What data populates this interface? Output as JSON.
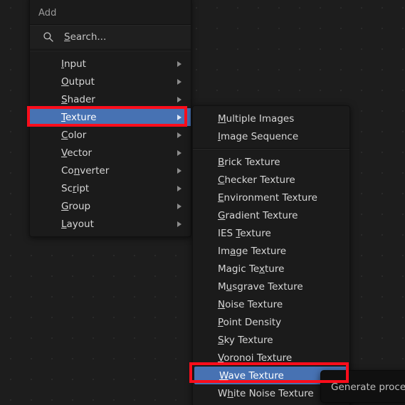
{
  "app": {
    "background_color": "#1d1d1d",
    "accent_color": "#4772b3",
    "annotation_color": "#fb0d1b"
  },
  "add_menu": {
    "title": "Add",
    "search": {
      "icon": "search-icon",
      "placeholder": "Search...",
      "value": ""
    },
    "items": [
      {
        "label": "Input",
        "accel": "I",
        "has_submenu": true,
        "selected": false
      },
      {
        "label": "Output",
        "accel": "O",
        "has_submenu": true,
        "selected": false
      },
      {
        "label": "Shader",
        "accel": "S",
        "has_submenu": true,
        "selected": false
      },
      {
        "label": "Texture",
        "accel": "T",
        "has_submenu": true,
        "selected": true
      },
      {
        "label": "Color",
        "accel": "C",
        "has_submenu": true,
        "selected": false
      },
      {
        "label": "Vector",
        "accel": "V",
        "has_submenu": true,
        "selected": false
      },
      {
        "label": "Converter",
        "accel": "n",
        "has_submenu": true,
        "selected": false
      },
      {
        "label": "Script",
        "accel": "r",
        "has_submenu": true,
        "selected": false
      },
      {
        "label": "Group",
        "accel": "G",
        "has_submenu": true,
        "selected": false
      },
      {
        "label": "Layout",
        "accel": "L",
        "has_submenu": true,
        "selected": false
      }
    ]
  },
  "texture_submenu": {
    "group_one": [
      {
        "label": "Multiple Images",
        "accel": "M",
        "selected": false
      },
      {
        "label": "Image Sequence",
        "accel": "I",
        "selected": false
      }
    ],
    "group_two": [
      {
        "label": "Brick Texture",
        "accel": "B",
        "selected": false
      },
      {
        "label": "Checker Texture",
        "accel": "C",
        "selected": false
      },
      {
        "label": "Environment Texture",
        "accel": "E",
        "selected": false
      },
      {
        "label": "Gradient Texture",
        "accel": "G",
        "selected": false
      },
      {
        "label": "IES Texture",
        "accel": "T",
        "selected": false
      },
      {
        "label": "Image Texture",
        "accel": "a",
        "selected": false
      },
      {
        "label": "Magic Texture",
        "accel": "x",
        "selected": false
      },
      {
        "label": "Musgrave Texture",
        "accel": "u",
        "selected": false
      },
      {
        "label": "Noise Texture",
        "accel": "N",
        "selected": false
      },
      {
        "label": "Point Density",
        "accel": "P",
        "selected": false
      },
      {
        "label": "Sky Texture",
        "accel": "S",
        "selected": false
      },
      {
        "label": "Voronoi Texture",
        "accel": "V",
        "selected": false
      },
      {
        "label": "Wave Texture",
        "accel": "W",
        "selected": true
      },
      {
        "label": "White Noise Texture",
        "accel": "h",
        "selected": false
      }
    ]
  },
  "tooltip": {
    "text": "Generate procedu"
  }
}
